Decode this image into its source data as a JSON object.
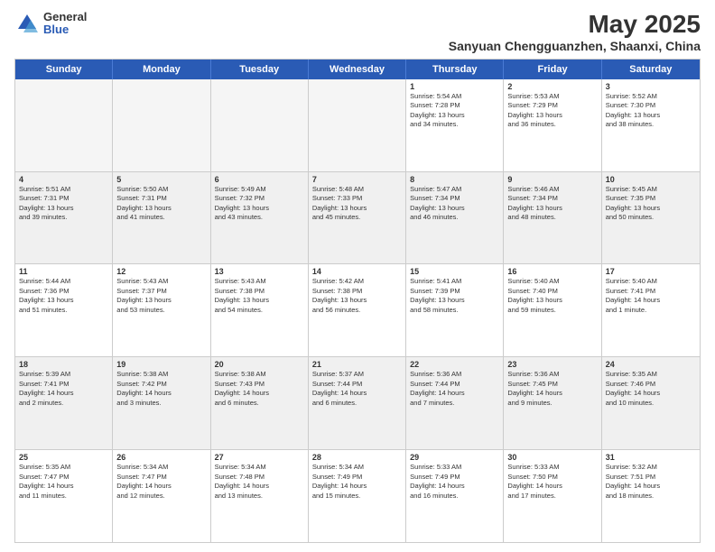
{
  "logo": {
    "general": "General",
    "blue": "Blue"
  },
  "title": "May 2025",
  "subtitle": "Sanyuan Chengguanzhen, Shaanxi, China",
  "header_days": [
    "Sunday",
    "Monday",
    "Tuesday",
    "Wednesday",
    "Thursday",
    "Friday",
    "Saturday"
  ],
  "weeks": [
    [
      {
        "day": "",
        "info": ""
      },
      {
        "day": "",
        "info": ""
      },
      {
        "day": "",
        "info": ""
      },
      {
        "day": "",
        "info": ""
      },
      {
        "day": "1",
        "info": "Sunrise: 5:54 AM\nSunset: 7:28 PM\nDaylight: 13 hours\nand 34 minutes."
      },
      {
        "day": "2",
        "info": "Sunrise: 5:53 AM\nSunset: 7:29 PM\nDaylight: 13 hours\nand 36 minutes."
      },
      {
        "day": "3",
        "info": "Sunrise: 5:52 AM\nSunset: 7:30 PM\nDaylight: 13 hours\nand 38 minutes."
      }
    ],
    [
      {
        "day": "4",
        "info": "Sunrise: 5:51 AM\nSunset: 7:31 PM\nDaylight: 13 hours\nand 39 minutes."
      },
      {
        "day": "5",
        "info": "Sunrise: 5:50 AM\nSunset: 7:31 PM\nDaylight: 13 hours\nand 41 minutes."
      },
      {
        "day": "6",
        "info": "Sunrise: 5:49 AM\nSunset: 7:32 PM\nDaylight: 13 hours\nand 43 minutes."
      },
      {
        "day": "7",
        "info": "Sunrise: 5:48 AM\nSunset: 7:33 PM\nDaylight: 13 hours\nand 45 minutes."
      },
      {
        "day": "8",
        "info": "Sunrise: 5:47 AM\nSunset: 7:34 PM\nDaylight: 13 hours\nand 46 minutes."
      },
      {
        "day": "9",
        "info": "Sunrise: 5:46 AM\nSunset: 7:34 PM\nDaylight: 13 hours\nand 48 minutes."
      },
      {
        "day": "10",
        "info": "Sunrise: 5:45 AM\nSunset: 7:35 PM\nDaylight: 13 hours\nand 50 minutes."
      }
    ],
    [
      {
        "day": "11",
        "info": "Sunrise: 5:44 AM\nSunset: 7:36 PM\nDaylight: 13 hours\nand 51 minutes."
      },
      {
        "day": "12",
        "info": "Sunrise: 5:43 AM\nSunset: 7:37 PM\nDaylight: 13 hours\nand 53 minutes."
      },
      {
        "day": "13",
        "info": "Sunrise: 5:43 AM\nSunset: 7:38 PM\nDaylight: 13 hours\nand 54 minutes."
      },
      {
        "day": "14",
        "info": "Sunrise: 5:42 AM\nSunset: 7:38 PM\nDaylight: 13 hours\nand 56 minutes."
      },
      {
        "day": "15",
        "info": "Sunrise: 5:41 AM\nSunset: 7:39 PM\nDaylight: 13 hours\nand 58 minutes."
      },
      {
        "day": "16",
        "info": "Sunrise: 5:40 AM\nSunset: 7:40 PM\nDaylight: 13 hours\nand 59 minutes."
      },
      {
        "day": "17",
        "info": "Sunrise: 5:40 AM\nSunset: 7:41 PM\nDaylight: 14 hours\nand 1 minute."
      }
    ],
    [
      {
        "day": "18",
        "info": "Sunrise: 5:39 AM\nSunset: 7:41 PM\nDaylight: 14 hours\nand 2 minutes."
      },
      {
        "day": "19",
        "info": "Sunrise: 5:38 AM\nSunset: 7:42 PM\nDaylight: 14 hours\nand 3 minutes."
      },
      {
        "day": "20",
        "info": "Sunrise: 5:38 AM\nSunset: 7:43 PM\nDaylight: 14 hours\nand 6 minutes."
      },
      {
        "day": "21",
        "info": "Sunrise: 5:37 AM\nSunset: 7:44 PM\nDaylight: 14 hours\nand 6 minutes."
      },
      {
        "day": "22",
        "info": "Sunrise: 5:36 AM\nSunset: 7:44 PM\nDaylight: 14 hours\nand 7 minutes."
      },
      {
        "day": "23",
        "info": "Sunrise: 5:36 AM\nSunset: 7:45 PM\nDaylight: 14 hours\nand 9 minutes."
      },
      {
        "day": "24",
        "info": "Sunrise: 5:35 AM\nSunset: 7:46 PM\nDaylight: 14 hours\nand 10 minutes."
      }
    ],
    [
      {
        "day": "25",
        "info": "Sunrise: 5:35 AM\nSunset: 7:47 PM\nDaylight: 14 hours\nand 11 minutes."
      },
      {
        "day": "26",
        "info": "Sunrise: 5:34 AM\nSunset: 7:47 PM\nDaylight: 14 hours\nand 12 minutes."
      },
      {
        "day": "27",
        "info": "Sunrise: 5:34 AM\nSunset: 7:48 PM\nDaylight: 14 hours\nand 13 minutes."
      },
      {
        "day": "28",
        "info": "Sunrise: 5:34 AM\nSunset: 7:49 PM\nDaylight: 14 hours\nand 15 minutes."
      },
      {
        "day": "29",
        "info": "Sunrise: 5:33 AM\nSunset: 7:49 PM\nDaylight: 14 hours\nand 16 minutes."
      },
      {
        "day": "30",
        "info": "Sunrise: 5:33 AM\nSunset: 7:50 PM\nDaylight: 14 hours\nand 17 minutes."
      },
      {
        "day": "31",
        "info": "Sunrise: 5:32 AM\nSunset: 7:51 PM\nDaylight: 14 hours\nand 18 minutes."
      }
    ]
  ]
}
